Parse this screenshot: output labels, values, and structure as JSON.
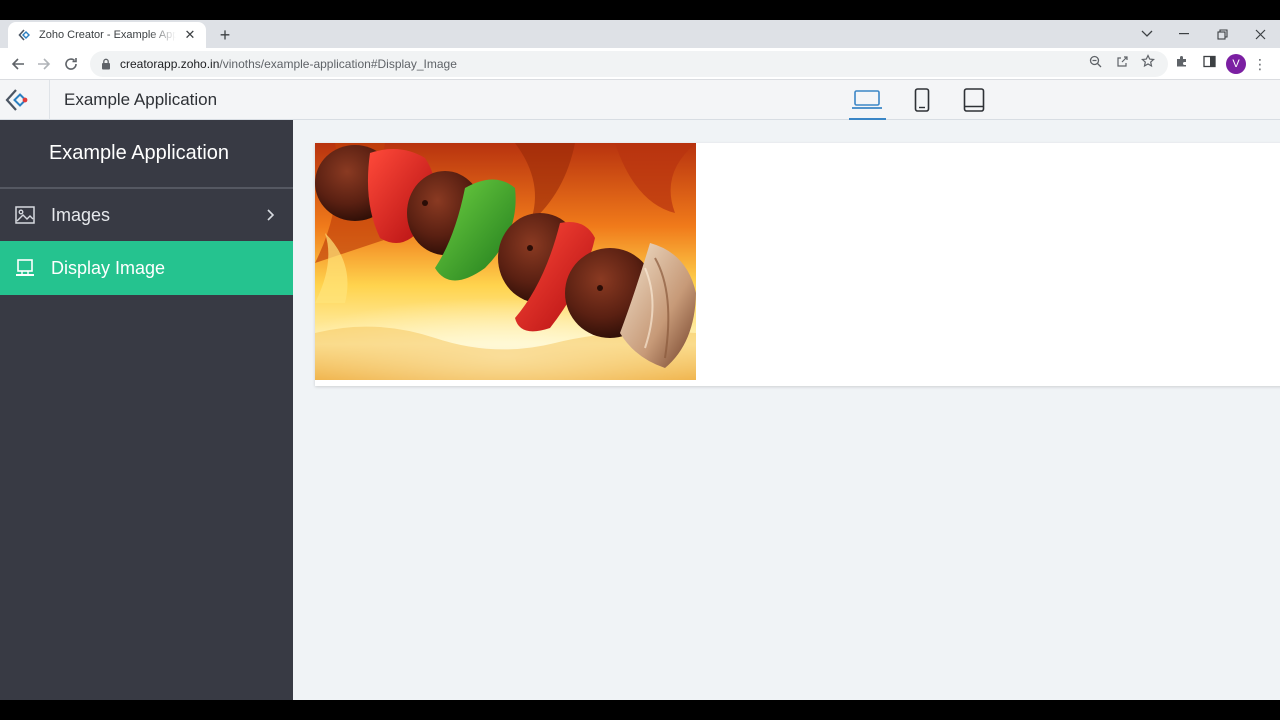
{
  "browser": {
    "tab_title": "Zoho Creator - Example Applicat",
    "url_host": "creatorapp.zoho.in",
    "url_path": "/vinoths/example-application#Display_Image",
    "profile_initial": "V"
  },
  "app": {
    "header_title": "Example Application",
    "device_modes": [
      "desktop-icon",
      "phone-icon",
      "tablet-icon"
    ],
    "active_device": "desktop-icon"
  },
  "sidebar": {
    "title": "Example Application",
    "items": [
      {
        "label": "Images",
        "icon": "image-icon",
        "has_submenu": true,
        "active": false
      },
      {
        "label": "Display Image",
        "icon": "monitor-icon",
        "has_submenu": false,
        "active": true
      }
    ]
  },
  "colors": {
    "sidebar_bg": "#383a44",
    "active_item": "#25c38f",
    "device_active": "#3b86c6",
    "content_bg": "#f0f3f6"
  }
}
